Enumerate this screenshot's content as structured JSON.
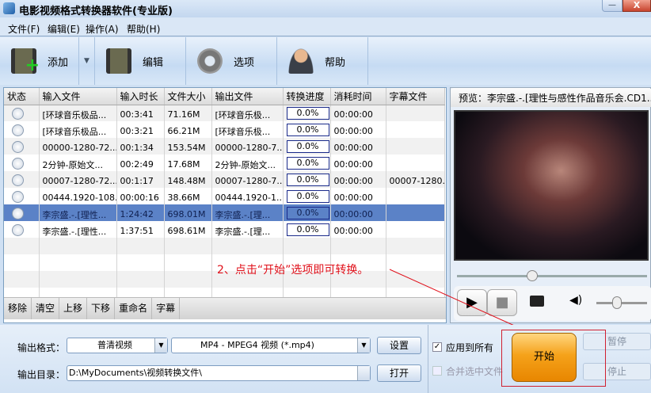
{
  "window": {
    "title": "电影视频格式转换器软件(专业版)",
    "minimize": "—",
    "close": "X"
  },
  "menu": [
    "文件(F)",
    "编辑(E)",
    "操作(A)",
    "帮助(H)"
  ],
  "toolbar": {
    "add": "添加",
    "edit": "编辑",
    "options": "选项",
    "help": "帮助"
  },
  "table": {
    "headers": [
      "状态",
      "输入文件",
      "输入时长",
      "文件大小",
      "输出文件",
      "转换进度",
      "消耗时间",
      "字幕文件"
    ],
    "rows": [
      [
        "[环球音乐极品...",
        "00:3:41",
        "71.16M",
        "[环球音乐极...",
        "0.0%",
        "00:00:00",
        ""
      ],
      [
        "[环球音乐极品...",
        "00:3:21",
        "66.21M",
        "[环球音乐极...",
        "0.0%",
        "00:00:00",
        ""
      ],
      [
        "00000-1280-72...",
        "00:1:34",
        "153.54M",
        "00000-1280-7...",
        "0.0%",
        "00:00:00",
        ""
      ],
      [
        "2分钟-原始文...",
        "00:2:49",
        "17.68M",
        "2分钟-原始文...",
        "0.0%",
        "00:00:00",
        ""
      ],
      [
        "00007-1280-72...",
        "00:1:17",
        "148.48M",
        "00007-1280-7...",
        "0.0%",
        "00:00:00",
        "00007-1280..."
      ],
      [
        "00444.1920-108...",
        "00:00:16",
        "38.66M",
        "00444.1920-1...",
        "0.0%",
        "00:00:00",
        ""
      ],
      [
        "李宗盛.-.[理性...",
        "1:24:42",
        "698.01M",
        "李宗盛.-.[理...",
        "0.0%",
        "00:00:00",
        ""
      ],
      [
        "李宗盛.-.[理性...",
        "1:37:51",
        "698.61M",
        "李宗盛.-.[理...",
        "0.0%",
        "00:00:00",
        ""
      ]
    ],
    "selected_row": 6
  },
  "list_buttons": [
    "移除",
    "清空",
    "上移",
    "下移",
    "重命名",
    "字幕"
  ],
  "preview": {
    "title": "预览：李宗盛.-.[理性与感性作品音乐会.CD1..."
  },
  "annotation": "2、点击“开始”选项即可转换。",
  "output": {
    "format_label": "输出格式：",
    "quality": "普清视频",
    "format": "MP4 - MPEG4 视频 (*.mp4)",
    "settings": "设置",
    "dir_label": "输出目录：",
    "dir": "D:\\MyDocuments\\视频转换文件\\",
    "open": "打开"
  },
  "options": {
    "apply_all": "应用到所有",
    "apply_all_checked": true,
    "merge": "合并选中文件",
    "merge_checked": false
  },
  "actions": {
    "start": "开始",
    "pause": "暂停",
    "stop": "停止"
  },
  "colors": {
    "selection": "#5b82c7",
    "start": "#f5a21a",
    "annotation": "#e0101a"
  }
}
